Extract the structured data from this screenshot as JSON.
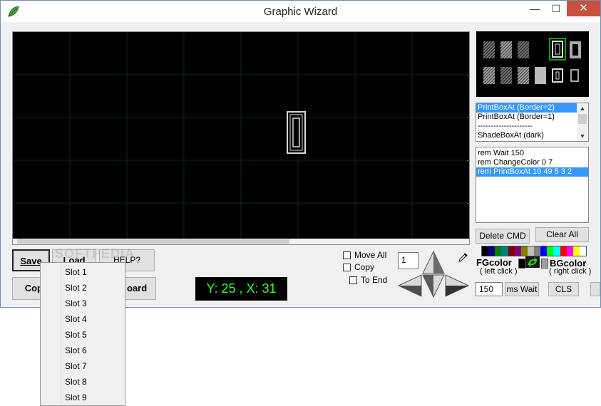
{
  "window": {
    "title": "Graphic Wizard",
    "minimize": "—",
    "maximize": "☐",
    "close": "✕"
  },
  "commands_list": {
    "items": [
      "PrintBoxAt (Border=2)",
      "PrintBoxAt (Border=1)",
      "---------------------",
      "ShadeBoxAt (dark)"
    ],
    "selected_index": 0
  },
  "script_list": {
    "items": [
      "rem Wait 150",
      "rem ChangeColor 0 7",
      "rem PrintBoxAt 10 49 5 3 2"
    ],
    "selected_index": 2
  },
  "buttons": {
    "delete_cmd": "Delete CMD",
    "clear_all": "Clear All",
    "save": "Save",
    "load": "Load",
    "help": "HELP?",
    "copy": "Cop",
    "clipboard": "oard",
    "ms_wait": "ms Wait",
    "cls": "CLS"
  },
  "options": {
    "move_all": "Move All",
    "copy": "Copy",
    "to_end": "To End"
  },
  "step_value": "1",
  "wait_value": "150",
  "coords": "Y: 25 , X: 31",
  "colors": {
    "fg_label": "FGcolor",
    "fg_hint": "( left click )",
    "bg_label": "BGcolor",
    "bg_hint": "( right click )",
    "palette": [
      "#000000",
      "#000080",
      "#008000",
      "#008080",
      "#800000",
      "#800080",
      "#808000",
      "#c0c0c0",
      "#808080",
      "#0000ff",
      "#00ff00",
      "#00ffff",
      "#ff0000",
      "#ff00ff",
      "#ffff00",
      "#ffffff"
    ]
  },
  "slot_menu": {
    "items": [
      "Slot 1",
      "Slot 2",
      "Slot 3",
      "Slot 4",
      "Slot 5",
      "Slot 6",
      "Slot 7",
      "Slot 8",
      "Slot 9"
    ]
  },
  "watermark": "SOFTPEDIA"
}
